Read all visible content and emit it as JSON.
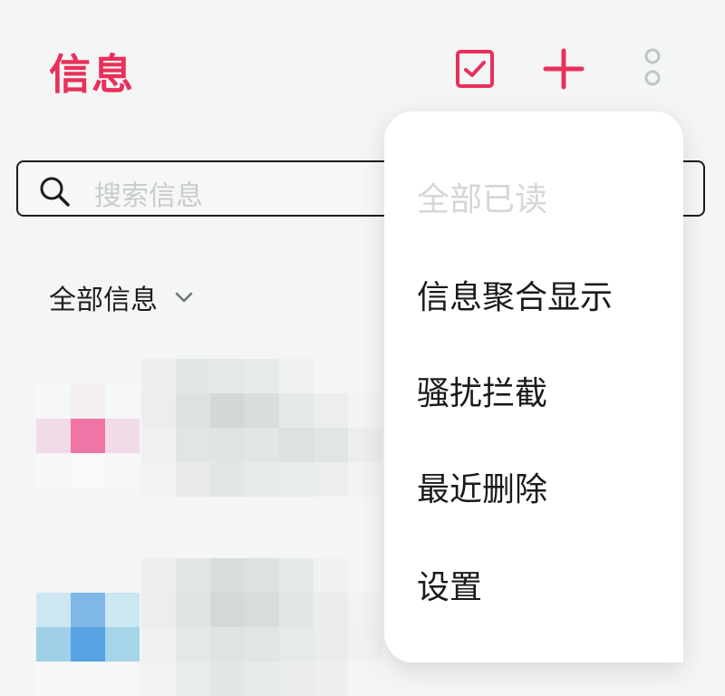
{
  "header": {
    "title": "信息",
    "icons": {
      "select": "checkbox-icon",
      "add": "plus-icon",
      "more": "more-vertical-icon"
    },
    "accent_color": "#e8315a"
  },
  "search": {
    "placeholder": "搜索信息"
  },
  "filter": {
    "label": "全部信息",
    "icon": "chevron-down-icon"
  },
  "message_list": {
    "items": [
      {
        "avatar_colors": [
          [
            "#f6f7f7",
            "#f4eff2",
            "#f6f7f7"
          ],
          [
            "#f2dbe8",
            "#ef75a7",
            "#f2dbe8"
          ],
          [
            "#f6f7f7",
            "#fbfafb",
            "#f6f7f7"
          ]
        ],
        "preview_colors": [
          [
            "#eef0f0",
            "#e2e6e6",
            "#e5e8e8",
            "#e8ebeb",
            "#eff1f1",
            "#f4f5f5",
            "#f4f5f5"
          ],
          [
            "#eceeee",
            "#dde1e1",
            "#d2d7d7",
            "#d8dddd",
            "#e6e9e9",
            "#eceeee",
            "#f2f3f3"
          ],
          [
            "#eff1f1",
            "#e2e5e5",
            "#e0e4e4",
            "#e3e6e6",
            "#dde1e1",
            "#e1e5e5",
            "#eceeee"
          ],
          [
            "#f1f2f2",
            "#e8eaea",
            "#e3e6e6",
            "#e8ebeb",
            "#e9ecec",
            "#eceeee",
            "#f1f2f2"
          ]
        ]
      },
      {
        "avatar_colors": [
          [
            "#cde8f2",
            "#7fb8e6",
            "#cbe7f1"
          ],
          [
            "#9fd0e7",
            "#57a3e4",
            "#a6d4e8"
          ],
          [
            "#f6f7f7",
            "#f6f7f7",
            "#f6f7f7"
          ]
        ],
        "preview_colors": [
          [
            "#eef0f0",
            "#e3e6e6",
            "#d8dddd",
            "#dde1e1",
            "#e6e9e9",
            "#f0f1f1",
            "#f4f5f5"
          ],
          [
            "#eceeee",
            "#dfe3e3",
            "#d3d8d8",
            "#d7dcdc",
            "#e4e7e7",
            "#ebeded",
            "#f1f2f2"
          ],
          [
            "#eff1f1",
            "#e5e8e8",
            "#dfe3e3",
            "#e2e5e5",
            "#e7eaea",
            "#ebeded",
            "#f0f1f1"
          ],
          [
            "#f1f2f2",
            "#e9ecec",
            "#e4e7e7",
            "#e8ebeb",
            "#ebeded",
            "#eef0f0",
            "#f3f4f4"
          ]
        ]
      }
    ]
  },
  "menu": {
    "items": [
      {
        "label": "全部已读",
        "disabled": true
      },
      {
        "label": "信息聚合显示",
        "disabled": false
      },
      {
        "label": "骚扰拦截",
        "disabled": false
      },
      {
        "label": "最近删除",
        "disabled": false
      },
      {
        "label": "设置",
        "disabled": false
      }
    ]
  }
}
